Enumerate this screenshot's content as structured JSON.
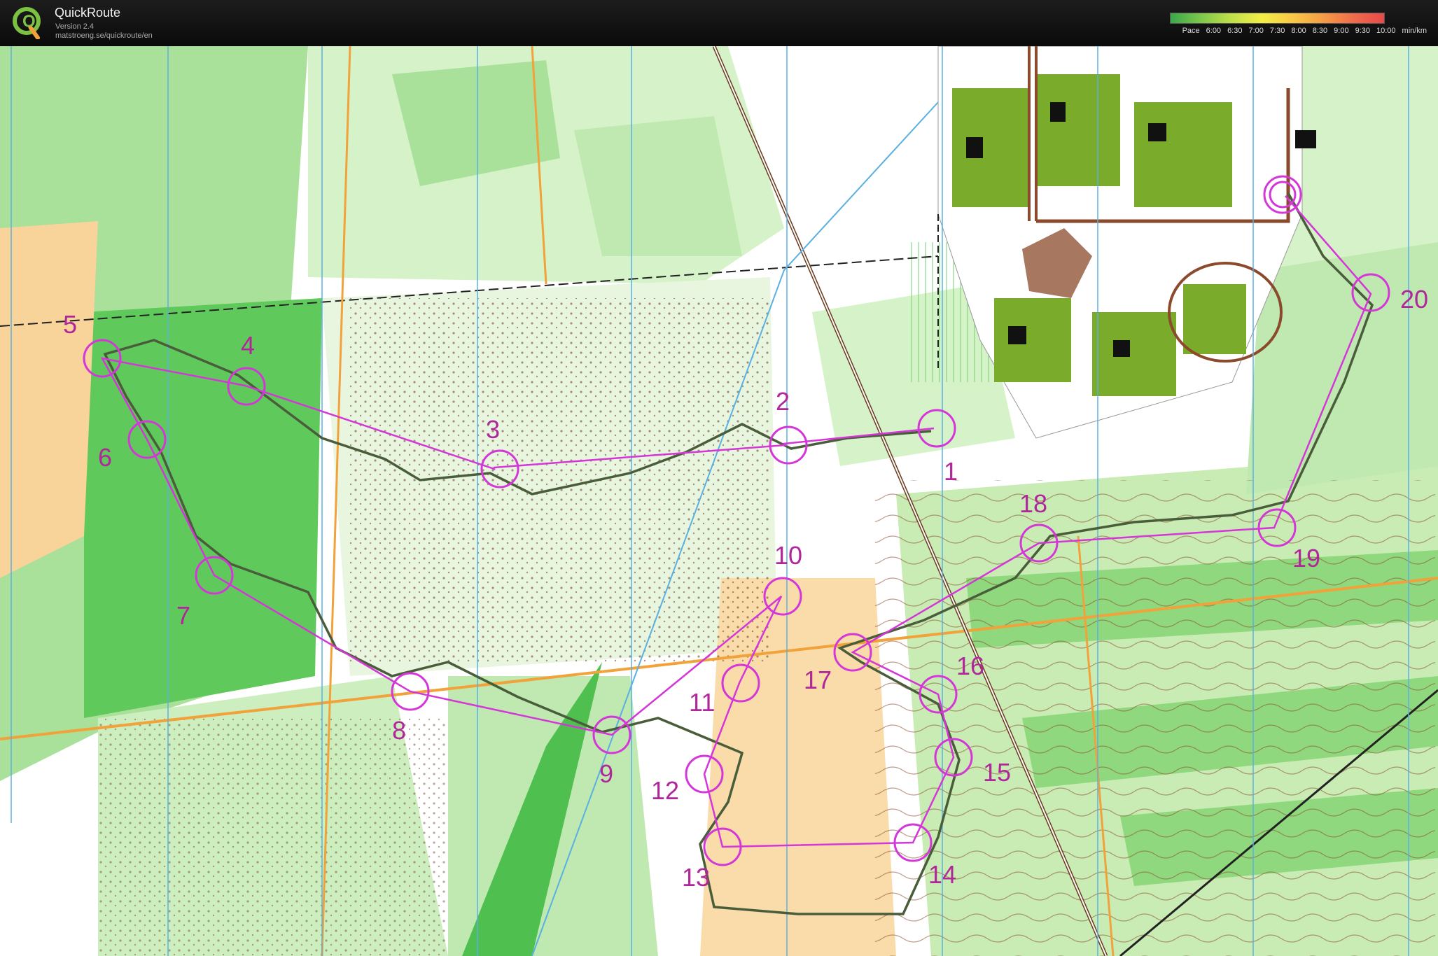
{
  "app": {
    "title": "QuickRoute",
    "version": "Version 2.4",
    "url": "matstroeng.se/quickroute/en"
  },
  "pace_legend": {
    "label": "Pace",
    "ticks": [
      "6:00",
      "6:30",
      "7:00",
      "7:30",
      "8:00",
      "8:30",
      "9:00",
      "9:30",
      "10:00"
    ],
    "unit": "min/km",
    "gradient_colors": [
      "#3aa84a",
      "#7ec84b",
      "#bfe04a",
      "#f3ee46",
      "#f9c846",
      "#f59c47",
      "#ef6c4a",
      "#e84a4a"
    ]
  },
  "map": {
    "colors": {
      "forest_green_light": "#c8ecb4",
      "forest_green_mid": "#8fd87e",
      "forest_green_dark": "#4fc04f",
      "open_yellow": "#f9d59a",
      "course_magenta": "#d436d8",
      "route_track": "#4a5d3a",
      "meridian_blue": "#5ab0e0",
      "contour_brown": "#8b4a2b"
    },
    "controls": [
      "1",
      "2",
      "3",
      "4",
      "5",
      "6",
      "7",
      "8",
      "9",
      "10",
      "11",
      "12",
      "13",
      "14",
      "15",
      "16",
      "17",
      "18",
      "19",
      "20"
    ]
  }
}
